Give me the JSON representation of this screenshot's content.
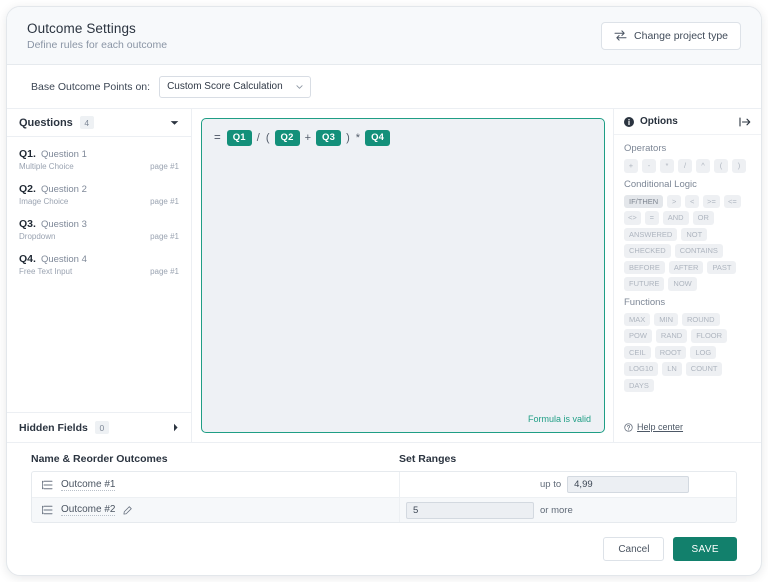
{
  "header": {
    "title": "Outcome Settings",
    "subtitle": "Define rules for each outcome",
    "change_project_type": "Change project type"
  },
  "base": {
    "label": "Base Outcome Points on:",
    "selected": "Custom Score Calculation"
  },
  "questions_panel": {
    "title": "Questions",
    "count": "4",
    "items": [
      {
        "num": "Q1.",
        "name": "Question 1",
        "type": "Multiple Choice",
        "page": "page #1"
      },
      {
        "num": "Q2.",
        "name": "Question 2",
        "type": "Image Choice",
        "page": "page #1"
      },
      {
        "num": "Q3.",
        "name": "Question 3",
        "type": "Dropdown",
        "page": "page #1"
      },
      {
        "num": "Q4.",
        "name": "Question 4",
        "type": "Free Text Input",
        "page": "page #1"
      }
    ],
    "hidden_fields_title": "Hidden Fields",
    "hidden_fields_count": "0"
  },
  "formula": {
    "equals": "=",
    "tokens": [
      {
        "kind": "pill",
        "text": "Q1"
      },
      {
        "kind": "op",
        "text": "/"
      },
      {
        "kind": "op",
        "text": "("
      },
      {
        "kind": "pill",
        "text": "Q2"
      },
      {
        "kind": "op",
        "text": "+"
      },
      {
        "kind": "pill",
        "text": "Q3"
      },
      {
        "kind": "op",
        "text": ")"
      },
      {
        "kind": "op",
        "text": "*"
      },
      {
        "kind": "pill",
        "text": "Q4"
      }
    ],
    "validity": "Formula is valid",
    "accent_color": "#13907a"
  },
  "options": {
    "title": "Options",
    "groups": [
      {
        "label": "Operators",
        "chips": [
          "+",
          "-",
          "*",
          "/",
          "^",
          "(",
          ")"
        ],
        "symbolic": true
      },
      {
        "label": "Conditional Logic",
        "chips": [
          "IF/THEN",
          ">",
          "<",
          ">=",
          "<=",
          "<>",
          "=",
          "AND",
          "OR",
          "ANSWERED",
          "NOT",
          "CHECKED",
          "CONTAINS",
          "BEFORE",
          "AFTER",
          "PAST",
          "FUTURE",
          "NOW"
        ],
        "active_index": 0
      },
      {
        "label": "Functions",
        "chips": [
          "MAX",
          "MIN",
          "ROUND",
          "POW",
          "RAND",
          "FLOOR",
          "CEIL",
          "ROOT",
          "LOG",
          "LOG10",
          "LN",
          "COUNT",
          "DAYS"
        ]
      }
    ],
    "help_link": "Help center"
  },
  "outcomes": {
    "name_header": "Name & Reorder Outcomes",
    "ranges_header": "Set Ranges",
    "rows": [
      {
        "name": "Outcome #1",
        "range_label": "up to",
        "value": "4,99",
        "value_side": "right"
      },
      {
        "name": "Outcome #2",
        "range_label": "or more",
        "value": "5",
        "value_side": "left"
      }
    ]
  },
  "footer": {
    "cancel": "Cancel",
    "save": "SAVE",
    "save_color": "#12806c"
  }
}
